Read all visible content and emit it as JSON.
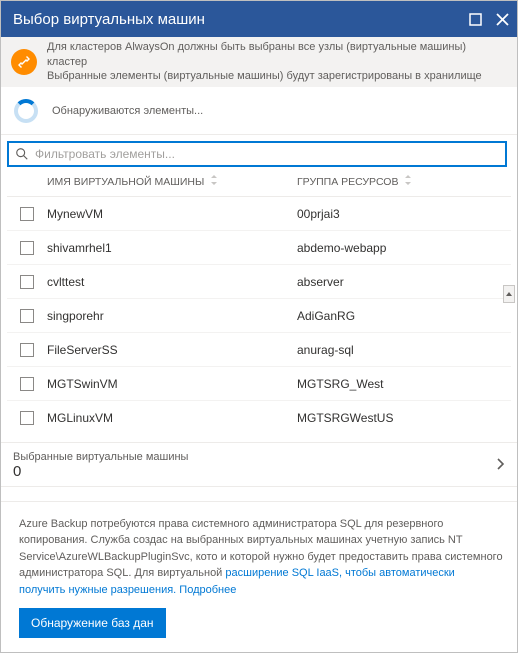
{
  "window": {
    "title": "Выбор виртуальных машин"
  },
  "banner": {
    "line1": "Для кластеров AlwaysOn должны быть выбраны все узлы (виртуальные машины) кластер",
    "line2": "Выбранные элементы (виртуальные машины) будут зарегистрированы в хранилище"
  },
  "discover": {
    "text": "Обнаруживаются элементы..."
  },
  "search": {
    "placeholder": "Фильтровать элементы..."
  },
  "columns": {
    "vm_name": "ИМЯ ВИРТУАЛЬНОЙ МАШИНЫ",
    "resource_group": "ГРУППА РЕСУРСОВ"
  },
  "rows": [
    {
      "vm": "MynewVM",
      "rg": "00prjai3"
    },
    {
      "vm": "shivamrhel1",
      "rg": "abdemo-webapp"
    },
    {
      "vm": "cvlttest",
      "rg": "abserver"
    },
    {
      "vm": "singporehr",
      "rg": "AdiGanRG"
    },
    {
      "vm": "FileServerSS",
      "rg": "anurag-sql"
    },
    {
      "vm": "MGTSwinVM",
      "rg": "MGTSRG_West"
    },
    {
      "vm": "MGLinuxVM",
      "rg": "MGTSRGWestUS"
    }
  ],
  "selected": {
    "label": "Выбранные виртуальные машины",
    "count": "0"
  },
  "info": {
    "text_plain": "Azure Backup потребуются права системного администратора SQL для резервного копирования. Служба создас на выбранных виртуальных машинах учетную запись NT Service\\AzureWLBackupPluginSvc, кото и которой нужно будет предоставить права системного администратора SQL. Для виртуальной ",
    "text_link": "расширение SQL IaaS, чтобы автоматически получить нужные разрешения. Подробнее"
  },
  "buttons": {
    "discover_db": "Обнаружение баз дан"
  },
  "colors": {
    "primary": "#0078d4",
    "header": "#2b579a",
    "warn": "#ff8c00"
  }
}
